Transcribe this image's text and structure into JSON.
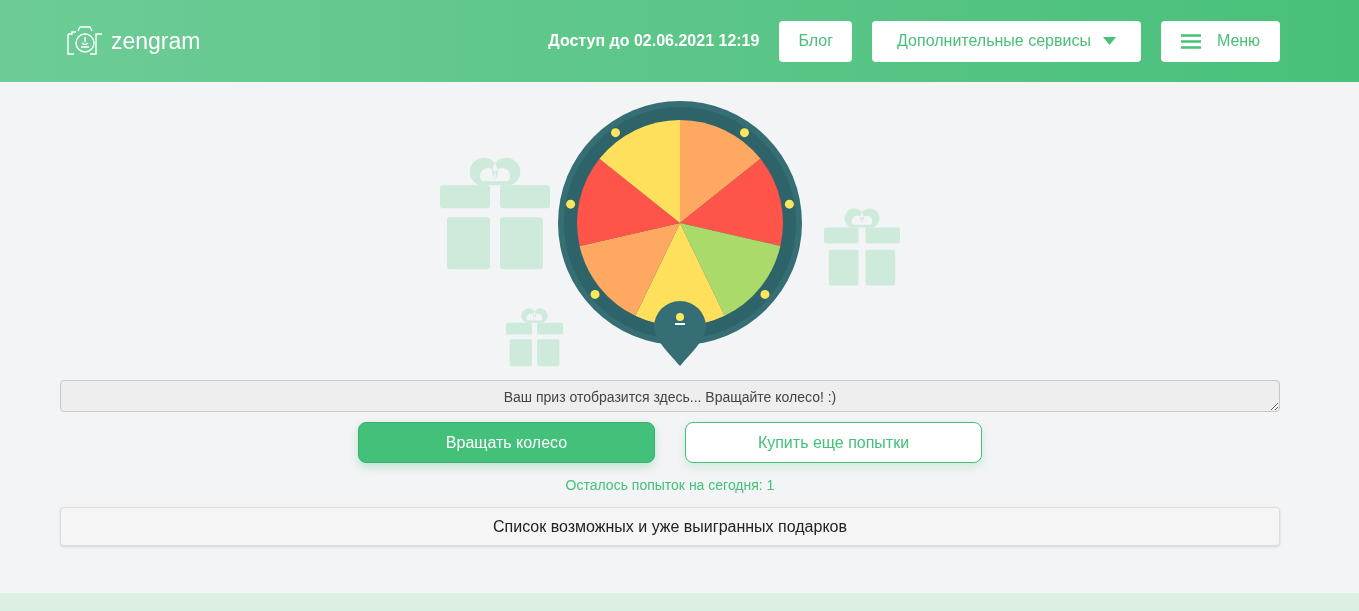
{
  "header": {
    "logo": "zengram",
    "access": "Доступ до 02.06.2021 12:19",
    "blog_button": "Блог",
    "services_button": "Дополнительные сервисы",
    "menu_button": "Меню"
  },
  "prize_field": {
    "placeholder": "Ваш приз отобразится здесь... Вращайте колесо! :)"
  },
  "spin_button": "Вращать колесо",
  "buy_button": "Купить еще попытки",
  "attempts_left": "Осталось попыток на сегодня: 1",
  "gifts_panel": {
    "title": "Список возможных и уже выигранных подарков"
  }
}
